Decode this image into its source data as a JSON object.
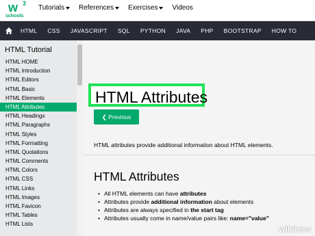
{
  "logo": {
    "mark": "w",
    "sup": "3",
    "text": "schools"
  },
  "topnav": [
    {
      "label": "Tutorials"
    },
    {
      "label": "References"
    },
    {
      "label": "Exercises"
    },
    {
      "label": "Videos"
    }
  ],
  "darknav": [
    "HTML",
    "CSS",
    "JAVASCRIPT",
    "SQL",
    "PYTHON",
    "JAVA",
    "PHP",
    "BOOTSTRAP",
    "HOW TO"
  ],
  "sidebar": {
    "title": "HTML Tutorial",
    "items": [
      "HTML HOME",
      "HTML Introduction",
      "HTML Editors",
      "HTML Basic",
      "HTML Elements",
      "HTML Attributes",
      "HTML Headings",
      "HTML Paragraphs",
      "HTML Styles",
      "HTML Formatting",
      "HTML Quotations",
      "HTML Comments",
      "HTML Colors",
      "HTML CSS",
      "HTML Links",
      "HTML Images",
      "HTML Favicon",
      "HTML Tables",
      "HTML Lists"
    ],
    "active_index": 5
  },
  "main": {
    "title": "HTML Attributes",
    "prev_button": "❮ Previous",
    "intro": "HTML attributes provide additional information about HTML elements.",
    "section_title": "HTML Attributes",
    "bullets": [
      {
        "pre": "All HTML elements can have ",
        "bold": "attributes",
        "post": ""
      },
      {
        "pre": "Attributes provide ",
        "bold": "additional information",
        "post": " about elements"
      },
      {
        "pre": "Attributes are always specified in ",
        "bold": "the start tag",
        "post": ""
      },
      {
        "pre": "Attributes usually come in name/value pairs like: ",
        "bold": "name=\"value\"",
        "post": ""
      }
    ]
  },
  "watermark": {
    "bold": "wiki",
    "rest": "How"
  },
  "colors": {
    "accent": "#04AA6D",
    "dark_nav": "#282A35",
    "sidebar": "#E7E9EB",
    "highlight": "#22e05a"
  }
}
